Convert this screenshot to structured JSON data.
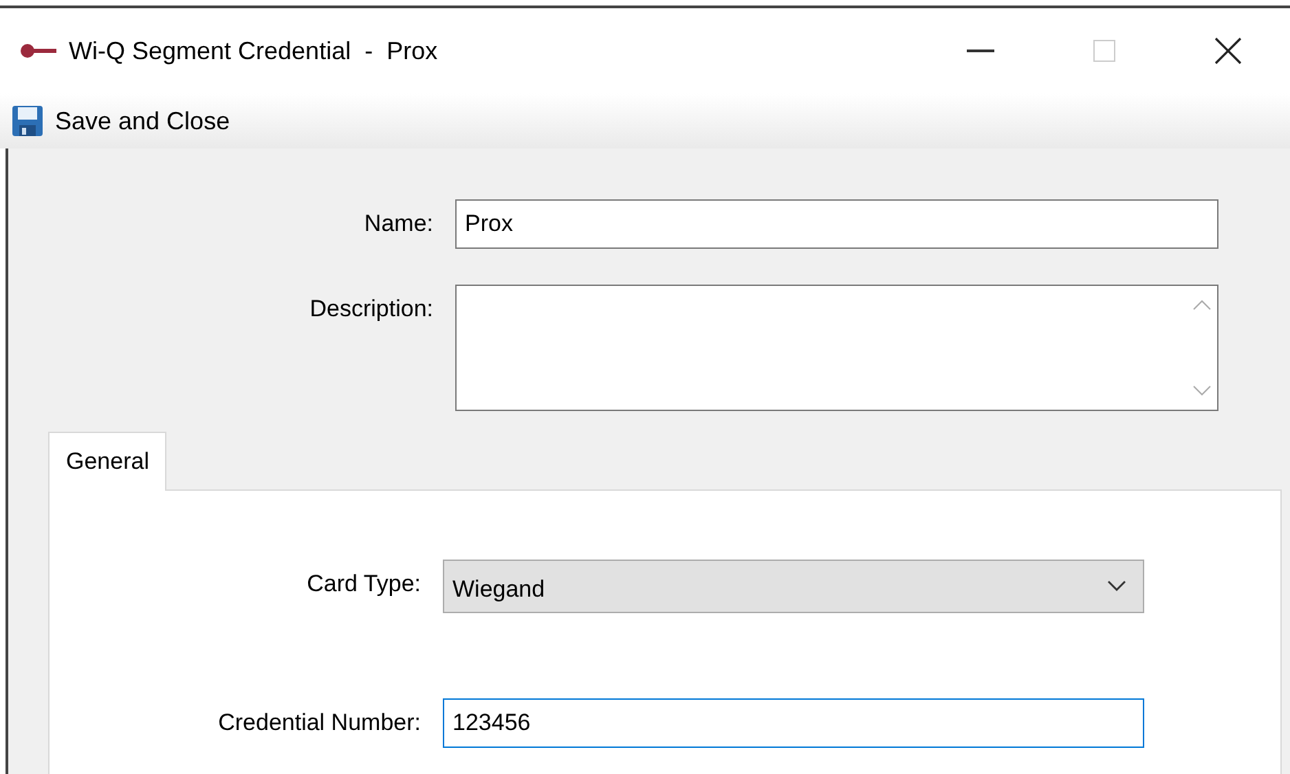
{
  "window": {
    "title": "Wi-Q Segment Credential  -  Prox"
  },
  "toolbar": {
    "buttons": [
      {
        "label": "Save and Close"
      }
    ]
  },
  "fields": [
    {
      "kind": "text",
      "label": "Name:",
      "value": "Prox",
      "focused": false
    },
    {
      "kind": "multiline",
      "label": "Description:",
      "focused": false
    }
  ],
  "tabs": [
    {
      "label": "General",
      "selected": true
    }
  ],
  "tab_fields": [
    {
      "kind": "dropdown",
      "label": "Card Type:",
      "value": "Wiegand",
      "focused": false
    },
    {
      "kind": "text",
      "label": "Credential Number:",
      "value": "123456",
      "focused": true
    }
  ]
}
